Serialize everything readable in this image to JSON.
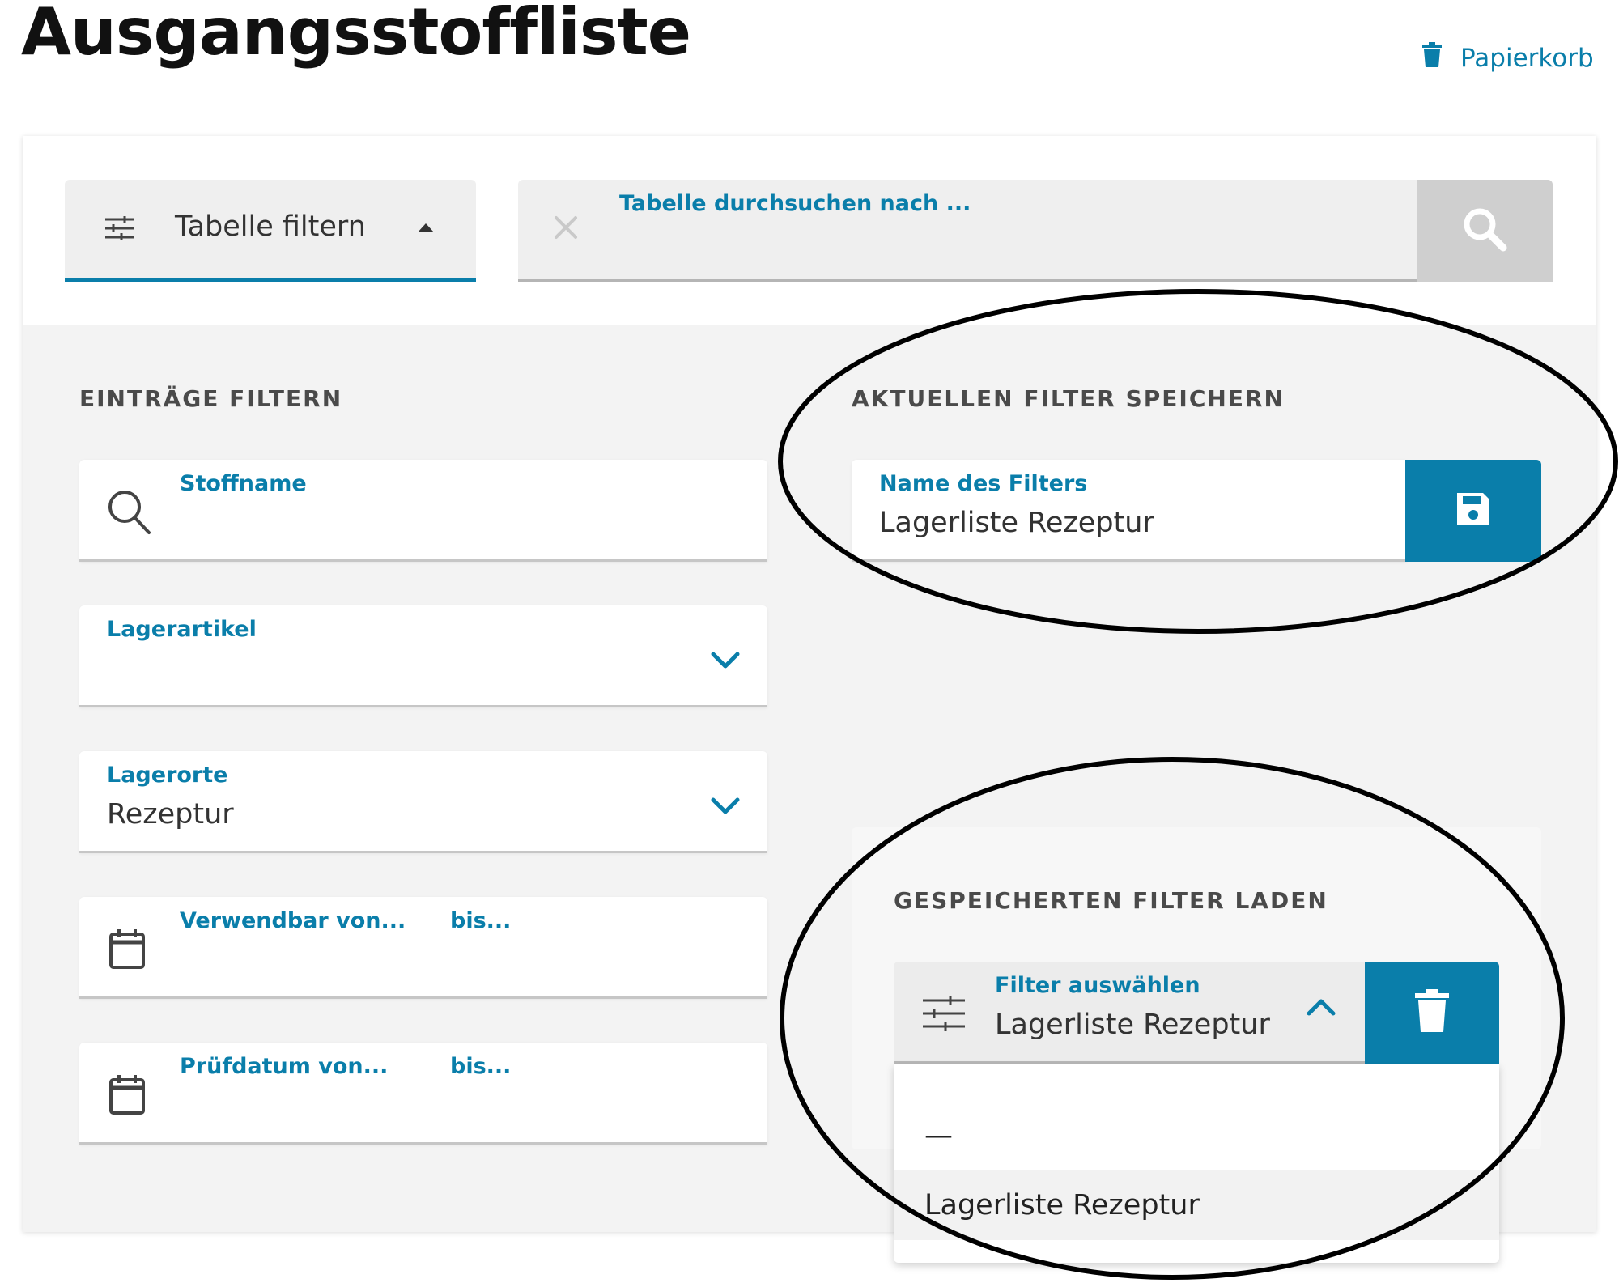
{
  "header": {
    "title": "Ausgangsstoffliste",
    "trash_label": "Papierkorb"
  },
  "toolbar": {
    "filter_toggle_label": "Tabelle filtern",
    "search_label": "Tabelle durchsuchen nach ...",
    "search_value": ""
  },
  "filter_entries": {
    "heading": "EINTRÄGE FILTERN",
    "substance_label": "Stoffname",
    "substance_value": "",
    "stock_item_label": "Lagerartikel",
    "stock_item_value": "",
    "storage_label": "Lagerorte",
    "storage_value": "Rezeptur",
    "usable_from_label": "Verwendbar von...",
    "usable_to_label": "bis...",
    "test_from_label": "Prüfdatum von...",
    "test_to_label": "bis..."
  },
  "save_filter": {
    "heading": "AKTUELLEN FILTER SPEICHERN",
    "name_label": "Name des Filters",
    "name_value": "Lagerliste Rezeptur"
  },
  "load_filter": {
    "heading": "GESPEICHERTEN FILTER LADEN",
    "select_label": "Filter auswählen",
    "select_value": "Lagerliste Rezeptur",
    "options": [
      "—",
      "Lagerliste Rezeptur"
    ]
  },
  "colors": {
    "accent": "#0a7eaa",
    "panel_bg": "#f3f3f3",
    "field_bg": "#ffffff",
    "annotation": "#000000"
  }
}
